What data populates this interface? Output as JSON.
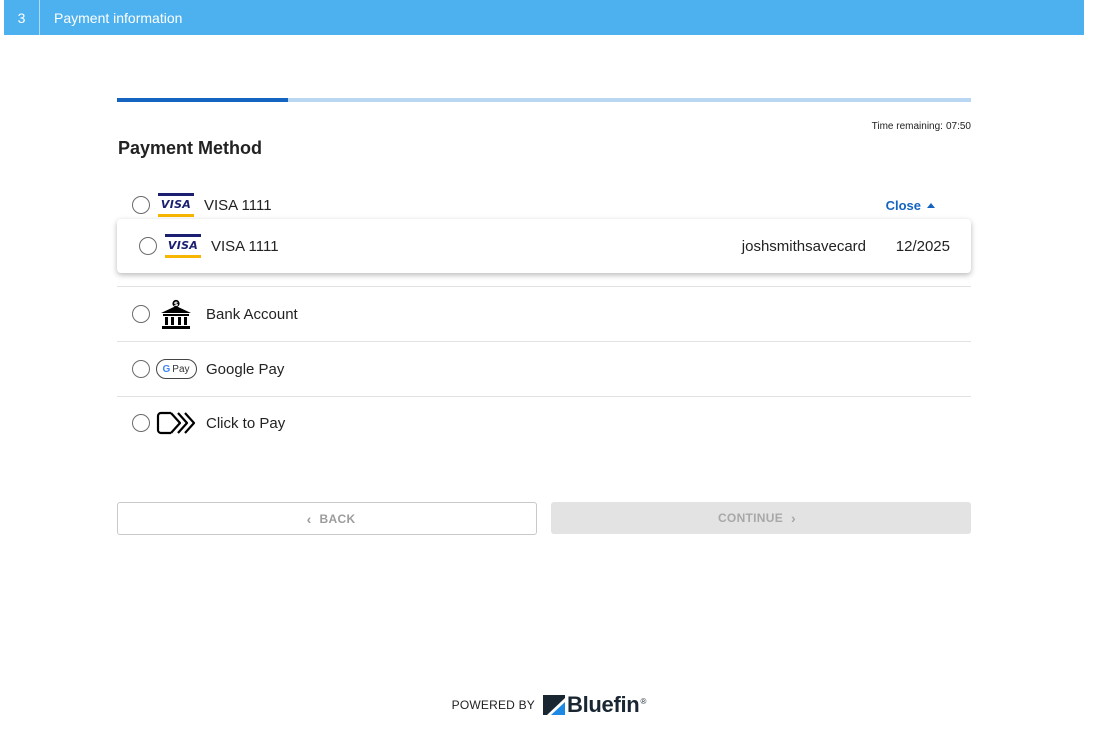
{
  "header": {
    "step_number": "3",
    "step_title": "Payment information"
  },
  "progress": {
    "fraction": 0.2
  },
  "timer": {
    "label": "Time remaining:",
    "value": "07:50"
  },
  "page": {
    "title": "Payment Method"
  },
  "methods": {
    "card": {
      "brand_text": "VISA",
      "label": "VISA 1111",
      "close_label": "Close"
    },
    "saved_card": {
      "brand_text": "VISA",
      "label": "VISA 1111",
      "nickname": "joshsmithsavecard",
      "expiry": "12/2025"
    },
    "bank": {
      "label": "Bank Account",
      "icon": "bank-icon"
    },
    "google_pay": {
      "label": "Google Pay",
      "badge_g": "G",
      "badge_text": "Pay"
    },
    "click_to_pay": {
      "label": "Click to Pay",
      "icon": "click-to-pay-icon"
    }
  },
  "buttons": {
    "back": "BACK",
    "continue": "CONTINUE"
  },
  "footer": {
    "powered_by": "POWERED BY",
    "brand": "Bluefin",
    "brand_reg": "®"
  },
  "colors": {
    "topbar": "#4db1ef",
    "accent": "#1565c0",
    "progress_track": "#b9d6f2",
    "visa_blue": "#1a1f71",
    "visa_gold": "#f7b600"
  }
}
